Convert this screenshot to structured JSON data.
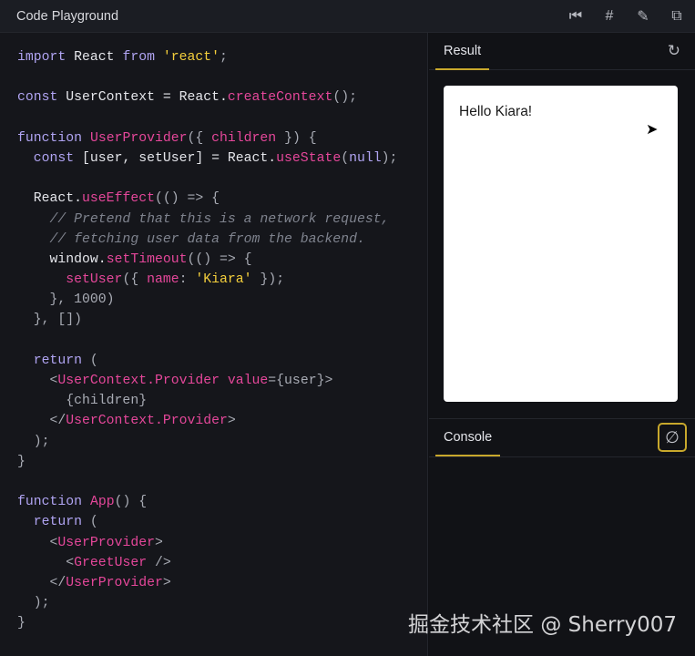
{
  "window": {
    "title": "Code Playground",
    "icons": [
      "reset-icon",
      "hash-icon",
      "pencil-icon",
      "external-link-icon"
    ]
  },
  "code": {
    "lines": [
      [
        [
          "import",
          "kw"
        ],
        [
          " React ",
          ""
        ],
        [
          "from",
          "kw"
        ],
        [
          " ",
          ""
        ],
        [
          "'react'",
          "str"
        ],
        [
          ";",
          "p"
        ]
      ],
      [],
      [
        [
          "const",
          "kw"
        ],
        [
          " UserContext = React.",
          ""
        ],
        [
          "createContext",
          "fn"
        ],
        [
          "();",
          "p"
        ]
      ],
      [],
      [
        [
          "function",
          "kw"
        ],
        [
          " ",
          ""
        ],
        [
          "UserProvider",
          "fn"
        ],
        [
          "({ ",
          "p"
        ],
        [
          "children",
          "fn"
        ],
        [
          " }) {",
          "p"
        ]
      ],
      [
        [
          "  ",
          ""
        ],
        [
          "const",
          "kw"
        ],
        [
          " [user, setUser] = React.",
          ""
        ],
        [
          "useState",
          "fn"
        ],
        [
          "(",
          "p"
        ],
        [
          "null",
          "kw"
        ],
        [
          ");",
          "p"
        ]
      ],
      [],
      [
        [
          "  React.",
          ""
        ],
        [
          "useEffect",
          "fn"
        ],
        [
          "(() => {",
          "p"
        ]
      ],
      [
        [
          "    // Pretend that this is a network request,",
          "cm"
        ]
      ],
      [
        [
          "    // fetching user data from the backend.",
          "cm"
        ]
      ],
      [
        [
          "    window.",
          ""
        ],
        [
          "setTimeout",
          "fn"
        ],
        [
          "(() => {",
          "p"
        ]
      ],
      [
        [
          "      ",
          ""
        ],
        [
          "setUser",
          "fn"
        ],
        [
          "({ ",
          "p"
        ],
        [
          "name",
          "fn"
        ],
        [
          ": ",
          "p"
        ],
        [
          "'Kiara'",
          "str"
        ],
        [
          " });",
          "p"
        ]
      ],
      [
        [
          "    }, 1000)",
          "p"
        ]
      ],
      [
        [
          "  }, [])",
          "p"
        ]
      ],
      [],
      [
        [
          "  ",
          ""
        ],
        [
          "return",
          "kw"
        ],
        [
          " (",
          "p"
        ]
      ],
      [
        [
          "    <",
          "p"
        ],
        [
          "UserContext.Provider",
          "fn"
        ],
        [
          " ",
          ""
        ],
        [
          "value",
          "fn"
        ],
        [
          "={user}>",
          "p"
        ]
      ],
      [
        [
          "      {children}",
          "p"
        ]
      ],
      [
        [
          "    </",
          "p"
        ],
        [
          "UserContext.Provider",
          "fn"
        ],
        [
          ">",
          "p"
        ]
      ],
      [
        [
          "  );",
          "p"
        ]
      ],
      [
        [
          "}",
          "p"
        ]
      ],
      [],
      [
        [
          "function",
          "kw"
        ],
        [
          " ",
          ""
        ],
        [
          "App",
          "fn"
        ],
        [
          "() {",
          "p"
        ]
      ],
      [
        [
          "  ",
          ""
        ],
        [
          "return",
          "kw"
        ],
        [
          " (",
          "p"
        ]
      ],
      [
        [
          "    <",
          "p"
        ],
        [
          "UserProvider",
          "fn"
        ],
        [
          ">",
          "p"
        ]
      ],
      [
        [
          "      <",
          "p"
        ],
        [
          "GreetUser",
          "fn"
        ],
        [
          " />",
          "p"
        ]
      ],
      [
        [
          "    </",
          "p"
        ],
        [
          "UserProvider",
          "fn"
        ],
        [
          ">",
          "p"
        ]
      ],
      [
        [
          "  );",
          "p"
        ]
      ],
      [
        [
          "}",
          "p"
        ]
      ]
    ]
  },
  "result": {
    "tab": "Result",
    "output": "Hello Kiara!"
  },
  "console": {
    "tab": "Console"
  },
  "watermark": "掘金技术社区 @ Sherry007",
  "colors": {
    "accent": "#c8a82c",
    "keyword": "#b0a4f2",
    "function": "#e5479a",
    "string": "#f4cf3c"
  }
}
